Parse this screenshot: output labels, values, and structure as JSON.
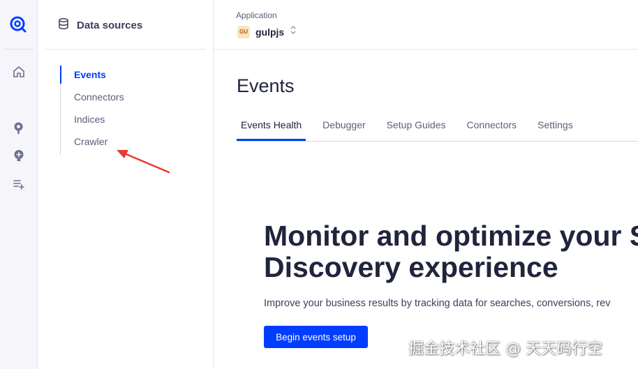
{
  "sidebar": {
    "title": "Data sources",
    "items": [
      {
        "label": "Events",
        "active": true
      },
      {
        "label": "Connectors",
        "active": false
      },
      {
        "label": "Indices",
        "active": false
      },
      {
        "label": "Crawler",
        "active": false
      }
    ]
  },
  "rail": {
    "icons": [
      "algolia-logo-icon",
      "home-icon",
      "search-icon",
      "lightbulb-icon",
      "list-add-icon"
    ]
  },
  "app": {
    "label": "Application",
    "badge": "GU",
    "name": "gulpjs"
  },
  "page": {
    "title": "Events",
    "tabs": [
      {
        "label": "Events Health",
        "active": true
      },
      {
        "label": "Debugger",
        "active": false
      },
      {
        "label": "Setup Guides",
        "active": false
      },
      {
        "label": "Connectors",
        "active": false
      },
      {
        "label": "Settings",
        "active": false
      }
    ]
  },
  "hero": {
    "title_line1": "Monitor and optimize your S",
    "title_line2": "Discovery experience",
    "description": "Improve your business results by tracking data for searches, conversions, rev",
    "cta_label": "Begin events setup"
  },
  "watermark": "掘金技术社区 @ 天天码行空",
  "colors": {
    "accent": "#003dff",
    "annotation_arrow": "#e8392f"
  }
}
